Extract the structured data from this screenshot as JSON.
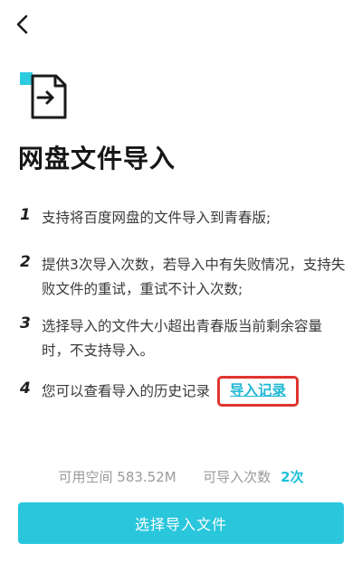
{
  "header": {
    "back_icon": "chevron-left-icon"
  },
  "hero": {
    "icon": "file-import-icon",
    "accent_color": "#2ecbe0"
  },
  "title": "网盘文件导入",
  "steps": [
    {
      "num": "1",
      "text": "支持将百度网盘的文件导入到青春版;"
    },
    {
      "num": "2",
      "text": "提供3次导入次数，若导入中有失败情况，支持失败文件的重试，重试不计入次数;"
    },
    {
      "num": "3",
      "text": "选择导入的文件大小超出青春版当前剩余容量时，不支持导入。"
    },
    {
      "num": "4",
      "text": "您可以查看导入的历史记录",
      "link": "导入记录"
    }
  ],
  "stats": {
    "space_label": "可用空间",
    "space_value": "583.52M",
    "import_label": "可导入次数",
    "import_value": "2次"
  },
  "button": {
    "label": "选择导入文件",
    "color": "#29c6dc"
  }
}
